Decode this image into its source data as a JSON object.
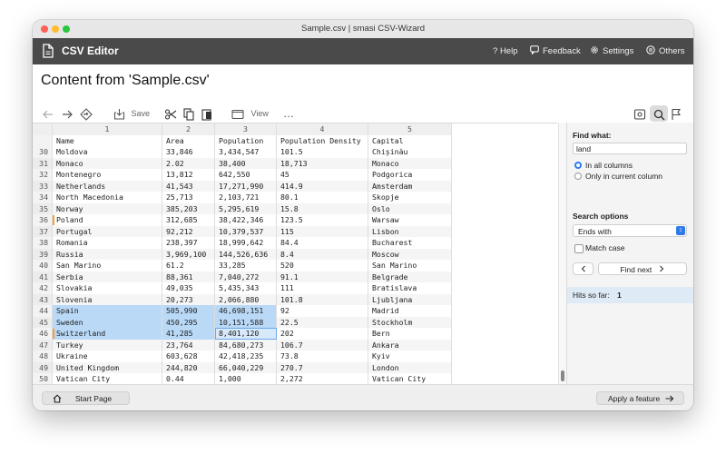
{
  "window": {
    "title": "Sample.csv  |  smasi CSV-Wizard"
  },
  "header": {
    "app_title": "CSV Editor",
    "help": "Help",
    "feedback": "Feedback",
    "settings": "Settings",
    "others": "Others"
  },
  "content_title": "Content from 'Sample.csv'",
  "toolbar": {
    "save": "Save",
    "view": "View",
    "more": "…"
  },
  "grid": {
    "col_numbers": [
      "1",
      "2",
      "3",
      "4",
      "5"
    ],
    "headers": [
      "Name",
      "Area",
      "Population",
      "Population Density",
      "Capital"
    ],
    "rows": [
      {
        "n": "30",
        "c": [
          "Moldova",
          "33,846",
          "3,434,547",
          "101.5",
          "Chișinău"
        ]
      },
      {
        "n": "31",
        "c": [
          "Monaco",
          "2.02",
          "38,400",
          "18,713",
          "Monaco"
        ]
      },
      {
        "n": "32",
        "c": [
          "Montenegro",
          "13,812",
          "642,550",
          "45",
          "Podgorica"
        ]
      },
      {
        "n": "33",
        "c": [
          "Netherlands",
          "41,543",
          "17,271,990",
          "414.9",
          "Amsterdam"
        ]
      },
      {
        "n": "34",
        "c": [
          "North Macedonia",
          "25,713",
          "2,103,721",
          "80.1",
          "Skopje"
        ]
      },
      {
        "n": "35",
        "c": [
          "Norway",
          "385,203",
          "5,295,619",
          "15.8",
          "Oslo"
        ]
      },
      {
        "n": "36",
        "c": [
          "Poland",
          "312,685",
          "38,422,346",
          "123.5",
          "Warsaw"
        ]
      },
      {
        "n": "37",
        "c": [
          "Portugal",
          "92,212",
          "10,379,537",
          "115",
          "Lisbon"
        ]
      },
      {
        "n": "38",
        "c": [
          "Romania",
          "238,397",
          "18,999,642",
          "84.4",
          "Bucharest"
        ]
      },
      {
        "n": "39",
        "c": [
          "Russia",
          "3,969,100",
          "144,526,636",
          "8.4",
          "Moscow"
        ]
      },
      {
        "n": "40",
        "c": [
          "San Marino",
          "61.2",
          "33,285",
          "520",
          "San Marino"
        ]
      },
      {
        "n": "41",
        "c": [
          "Serbia",
          "88,361",
          "7,040,272",
          "91.1",
          "Belgrade"
        ]
      },
      {
        "n": "42",
        "c": [
          "Slovakia",
          "49,035",
          "5,435,343",
          "111",
          "Bratislava"
        ]
      },
      {
        "n": "43",
        "c": [
          "Slovenia",
          "20,273",
          "2,066,880",
          "101.8",
          "Ljubljana"
        ]
      },
      {
        "n": "44",
        "c": [
          "Spain",
          "505,990",
          "46,698,151",
          "92",
          "Madrid"
        ]
      },
      {
        "n": "45",
        "c": [
          "Sweden",
          "450,295",
          "10,151,588",
          "22.5",
          "Stockholm"
        ]
      },
      {
        "n": "46",
        "c": [
          "Switzerland",
          "41,285",
          "8,401,120",
          "202",
          "Bern"
        ]
      },
      {
        "n": "47",
        "c": [
          "Turkey",
          "23,764",
          "84,680,273",
          "106.7",
          "Ankara"
        ]
      },
      {
        "n": "48",
        "c": [
          "Ukraine",
          "603,628",
          "42,418,235",
          "73.8",
          "Kyiv"
        ]
      },
      {
        "n": "49",
        "c": [
          "United Kingdom",
          "244,820",
          "66,040,229",
          "270.7",
          "London"
        ]
      },
      {
        "n": "50",
        "c": [
          "Vatican City",
          "0.44",
          "1,000",
          "2,272",
          "Vatican City"
        ]
      }
    ]
  },
  "find": {
    "find_what_label": "Find what:",
    "query": "land",
    "in_all_columns": "In all columns",
    "only_current": "Only in current column",
    "search_options_label": "Search options",
    "mode": "Ends with",
    "match_case": "Match case",
    "find_next": "Find next",
    "hits_label": "Hits so far:",
    "hits_value": "1"
  },
  "footer": {
    "start_page": "Start Page",
    "apply_feature": "Apply a feature"
  },
  "colors": {
    "accent": "#2f7bea",
    "selection": "#b9d9f7",
    "header_bg": "#4a4a4a",
    "marker": "#f0a035"
  }
}
